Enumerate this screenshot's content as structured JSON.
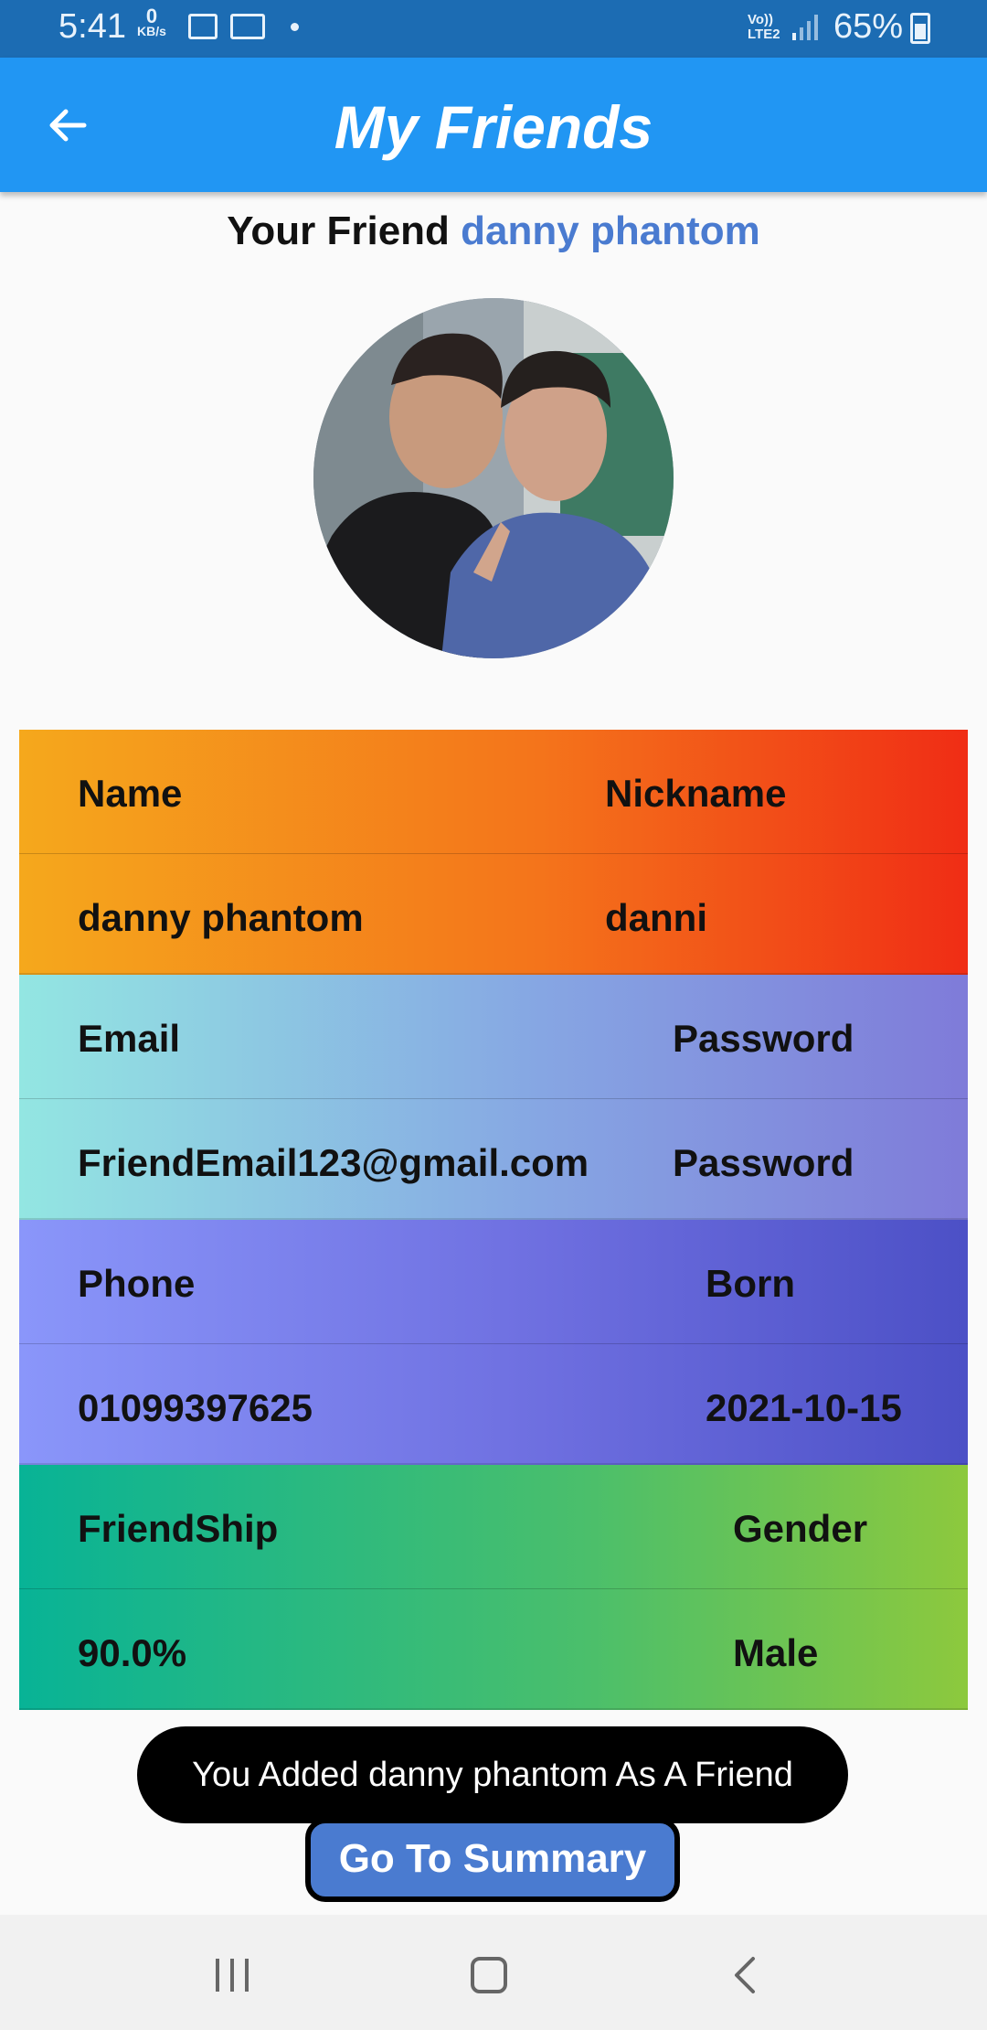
{
  "status_bar": {
    "time": "5:41",
    "net_speed_value": "0",
    "net_speed_unit": "KB/s",
    "network_label_top": "Vo))",
    "network_label_bottom": "LTE2",
    "battery_percent": "65%"
  },
  "app_bar": {
    "title": "My Friends"
  },
  "friend_heading": {
    "prefix": "Your Friend",
    "name": "danny phantom"
  },
  "details": {
    "name_label": "Name",
    "nickname_label": "Nickname",
    "name_value": "danny phantom",
    "nickname_value": "danni",
    "email_label": "Email",
    "password_label": "Password",
    "email_value": "FriendEmail123@gmail.com",
    "password_value": "Password",
    "phone_label": "Phone",
    "born_label": "Born",
    "phone_value": "01099397625",
    "born_value": "2021-10-15",
    "friendship_label": "FriendShip",
    "gender_label": "Gender",
    "friendship_value": "90.0%",
    "gender_value": "Male"
  },
  "toast": {
    "message": "You Added danny phantom As A Friend"
  },
  "summary_button": {
    "label": "Go To Summary"
  },
  "colors": {
    "status_bar": "#1c6cb3",
    "app_bar": "#2196f3",
    "accent_name": "#4a7bd0",
    "button": "#4a7bd0"
  }
}
